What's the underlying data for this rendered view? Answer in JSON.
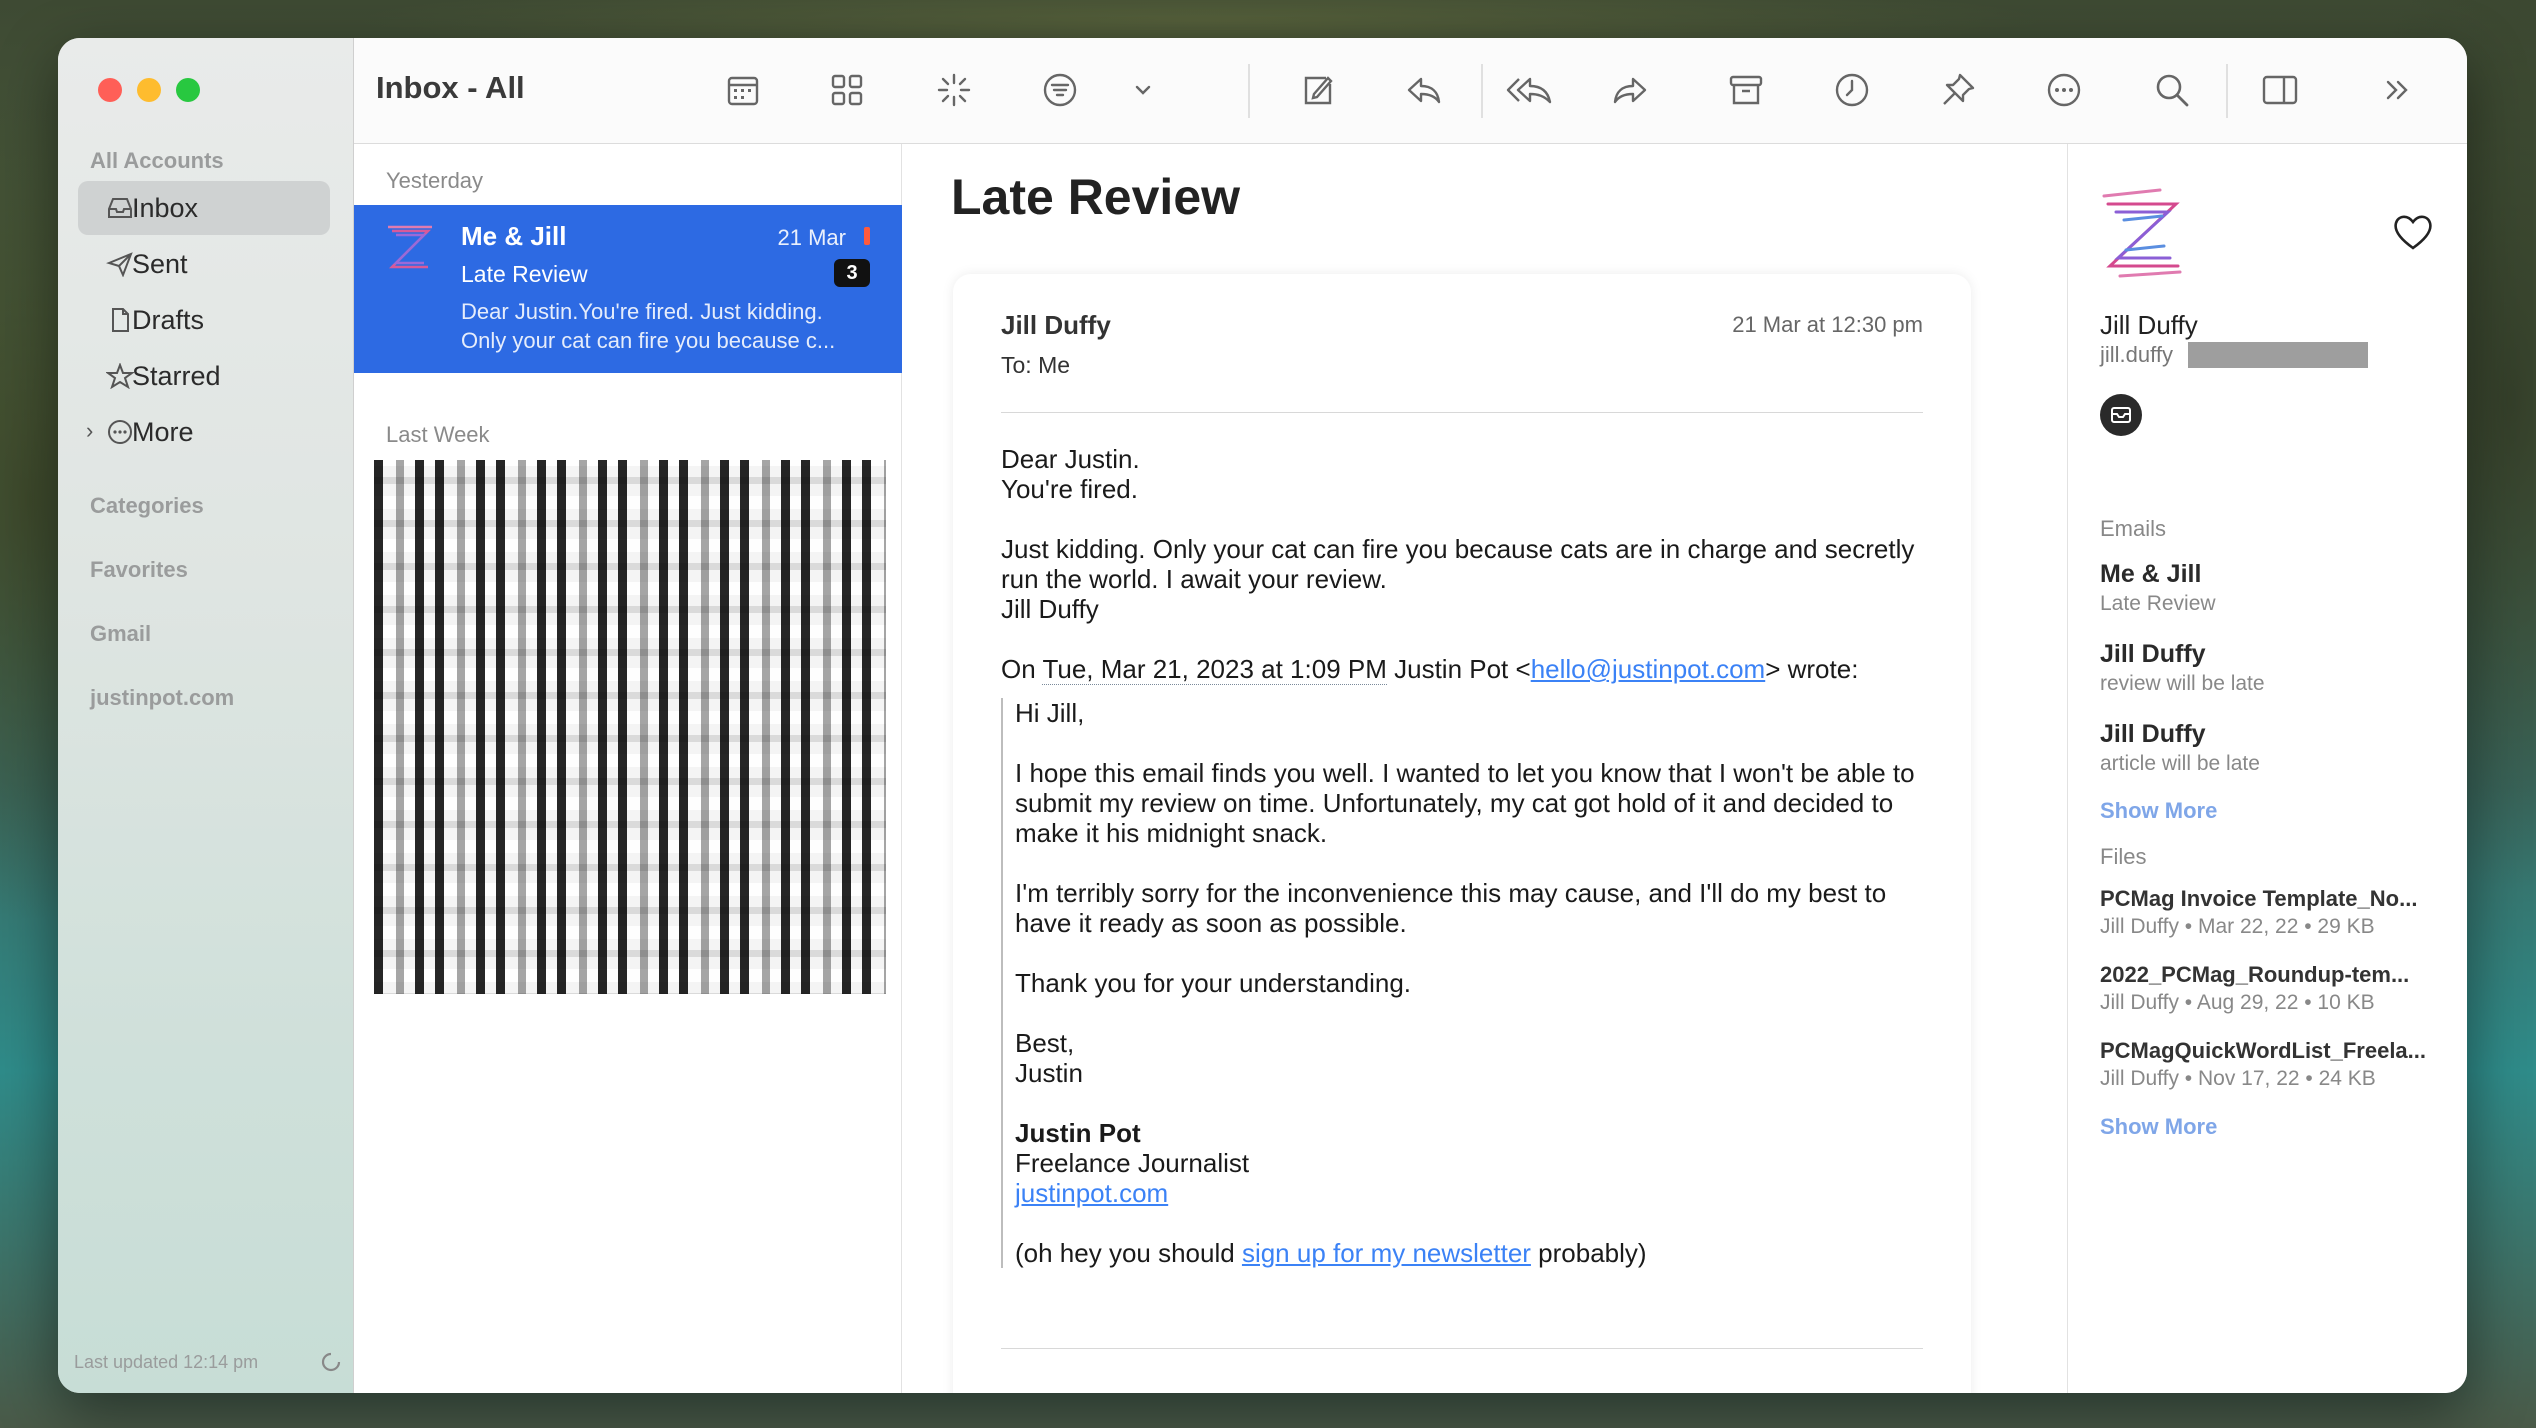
{
  "sidebar": {
    "section_accounts": "All Accounts",
    "items": [
      {
        "label": "Inbox",
        "icon": "inbox-icon"
      },
      {
        "label": "Sent",
        "icon": "paper-plane-icon"
      },
      {
        "label": "Drafts",
        "icon": "document-icon"
      },
      {
        "label": "Starred",
        "icon": "star-icon"
      },
      {
        "label": "More",
        "icon": "more-circle-icon"
      }
    ],
    "groups": [
      "Categories",
      "Favorites",
      "Gmail",
      "justinpot.com"
    ],
    "footer": "Last updated 12:14 pm"
  },
  "toolbar": {
    "title": "Inbox - All",
    "icons": [
      "calendar-icon",
      "grid-icon",
      "sparkle-icon",
      "filter-icon",
      "chevron-down-icon",
      "compose-icon",
      "reply-icon",
      "reply-all-icon",
      "forward-icon",
      "archive-icon",
      "clock-icon",
      "pin-icon",
      "more-icon",
      "search-icon",
      "sidebar-icon",
      "double-chevron-icon"
    ]
  },
  "list": {
    "header_yesterday": "Yesterday",
    "header_lastweek": "Last Week",
    "selected": {
      "from": "Me & Jill",
      "date": "21 Mar",
      "subject": "Late Review",
      "count": "3",
      "preview": "Dear Justin.You're fired. Just kidding. Only your cat can fire you because c..."
    }
  },
  "message": {
    "subject": "Late Review",
    "sender": "Jill Duffy",
    "sent_date": "21 Mar at 12:30 pm",
    "to": "To:  Me",
    "p1a": "Dear Justin.",
    "p1b": "You're fired.",
    "p2a": "Just kidding. Only your cat can fire you because cats are in charge and secretly run the world. I await your review.",
    "p2b": "Jill Duffy",
    "q_on": "On ",
    "q_date": "Tue, Mar 21, 2023 at 1:09 PM",
    "q_who": " Justin Pot <",
    "q_email": "hello@justinpot.com",
    "q_wrote": "> wrote:",
    "q1": "Hi Jill,",
    "q2": "I hope this email finds you well. I wanted to let you know that I won't be able to submit my review on time. Unfortunately, my cat got hold of it and decided to make it his midnight snack.",
    "q3": "I'm terribly sorry for the inconvenience this may cause, and I'll do my best to have it ready as soon as possible.",
    "q4": "Thank you for your understanding.",
    "q5a": "Best,",
    "q5b": "Justin",
    "sig_name": "Justin Pot",
    "sig_title": "Freelance Journalist",
    "sig_link": "justinpot.com",
    "ps_a": "(oh hey you should ",
    "ps_link": "sign up for my newsletter",
    "ps_b": " probably)"
  },
  "info": {
    "name": "Jill Duffy",
    "email": "jill.duffy",
    "emails_label": "Emails",
    "emails": [
      {
        "title": "Me & Jill",
        "sub": "Late Review"
      },
      {
        "title": "Jill Duffy",
        "sub": "review will be late"
      },
      {
        "title": "Jill Duffy",
        "sub": "article will be late"
      }
    ],
    "show_more": "Show More",
    "files_label": "Files",
    "files": [
      {
        "name": "PCMag Invoice Template_No...",
        "meta": "Jill Duffy • Mar 22, 22 • 29 KB"
      },
      {
        "name": "2022_PCMag_Roundup-tem...",
        "meta": "Jill Duffy • Aug 29, 22 • 10 KB"
      },
      {
        "name": "PCMagQuickWordList_Freela...",
        "meta": "Jill Duffy • Nov 17, 22 • 24 KB"
      }
    ],
    "show_more_files": "Show More"
  },
  "colors": {
    "accent": "#2d6ae3",
    "link": "#3b82f6",
    "flag": "#ff5a3c"
  }
}
